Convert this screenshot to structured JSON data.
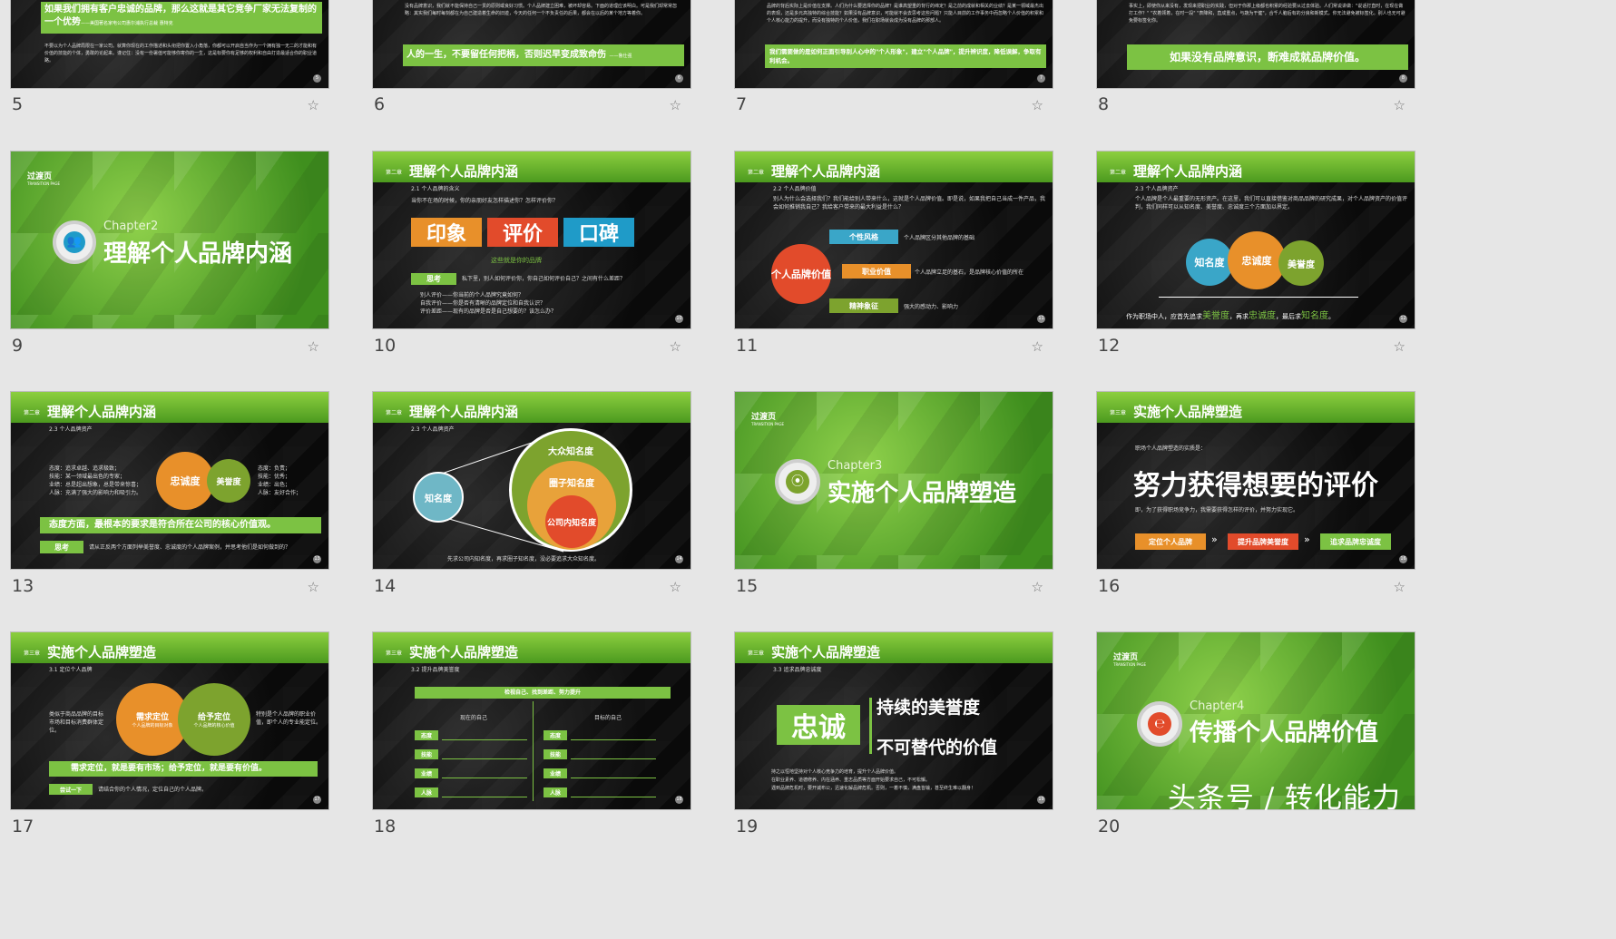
{
  "slides": [
    {
      "num": "5",
      "quote": "如果我们拥有客户忠诚的品牌，那么这就是其它竞争厂家无法复制的一个优势",
      "quote_src": "——美国著名家电公司惠尔浦执行总裁 惠特克",
      "body": "不要以为个人品牌局限在一家公司。就算你现在的工作描述和头衔把你置入小角落，你都可以开启自当作为一个拥有独一无二的才能和有价值的技能的个体，勇敢的论起来。谨记住：没有一份署值可能够你寄你的一生，这是标要你有足够的权利和自由打造最适合你的职业道路。"
    },
    {
      "num": "6",
      "body": "没有品牌意识，我们就不能保持自己一贯的原则或良好习惯。个人品牌建立困难，被坏却容易。下面的道理应该明白。可是我们却常常忽略：其实我们每时每刻都在为自己建造着生命的旧迹，今天的任何一个不负责任的后果，都会在以后的某个地方等着你。",
      "quote": "人的一生，不要留任何把柄，否则迟早变成致命伤",
      "quote_src": "——鲁仕强"
    },
    {
      "num": "7",
      "body": "品牌的背后实际上是价值在支撑。人们为什么要选择你的品牌？是谁高望重的背行的缔定？是之前的成就和相关的业绩？是某一领域最杰出的表现，还是多元高独特的综合技能？如果没有品牌意识，可能就不会去思考这些问题？只能人目前的工作事务中而忽略个人价值的积累和个人核心能力的提升，而没有独特的个人价值，我们在职场就会成为没有品牌的那部人。",
      "highlight": "我们需要做的是如何正面引导别人心中的\"个人形象\"，建立\"个人品牌\"，提升辨识度，降低误解，争取有利机会。"
    },
    {
      "num": "8",
      "body": "事实上，即使你从来没有，发现来把职业的实践，但对于你那上级都也积累的经验要从过去体验。人们常说讲做：\"说话打直时，在现在做打工作？\" \"农着领着，在时一段\" \"表降和，直成重点，与蔬为干健\"，合千人脑后有的分良和新模式，你无法避免被标签化。别人也无可避免要标签化你。",
      "bar": "如果没有品牌意识，断难成就品牌价值。"
    },
    {
      "num": "9",
      "label": "过渡页",
      "sub": "TRANSITION PAGE",
      "chapter": "Chapter2",
      "title": "理解个人品牌内涵"
    },
    {
      "num": "10",
      "chapter_tag": "第二章",
      "title": "理解个人品牌内涵",
      "subtitle": "2.1 个人品牌的含义",
      "q": "当你不在场的时候，你的亲朋好友怎样描述你？怎样评价你？",
      "tags": [
        "印象",
        "评价",
        "口碑"
      ],
      "tag_colors": [
        "#e8902a",
        "#e24b2b",
        "#1f9bc8"
      ],
      "caption": "这些就是你的品牌",
      "think": "思考",
      "think_text": "私下里，别人如何评价你，你自己如何评价自己？之间有什么差距？",
      "bullets": [
        "别人评价——你当前的个人品牌究竟如何？",
        "自我评价——你是否有清晰的品牌定位和自我认识？",
        "评价差距——现有的品牌是否是自己想要的？该怎么办？"
      ]
    },
    {
      "num": "11",
      "chapter_tag": "第二章",
      "title": "理解个人品牌内涵",
      "subtitle": "2.2 个人品牌价值",
      "intro": "别人为什么会选择我们？我们能给别人带来什么，这就是个人品牌价值。即是说，如果我把自己当成一件产品，我会如何推销我自己？我给客户带来的最大利益是什么？",
      "core": "个人品牌价值",
      "items": [
        {
          "label": "个性风格",
          "text": "个人品牌区分其他品牌的基础"
        },
        {
          "label": "职业价值",
          "text": "个人品牌立足的基石，是品牌核心价值的所在"
        },
        {
          "label": "精神象征",
          "text": "强大的感动力、影响力"
        }
      ]
    },
    {
      "num": "12",
      "chapter_tag": "第二章",
      "title": "理解个人品牌内涵",
      "subtitle": "2.3 个人品牌资产",
      "text": "个人品牌是个人最重要的无形资产。在这里，我们可以直接借鉴对商品品牌的研究成果，对个人品牌资产的价值评判，我们同样可以从知名度、美誉度、忠诚度三个方面加以界定。",
      "circles": [
        "知名度",
        "忠诚度",
        "美誉度"
      ],
      "conclusion_parts": [
        "作为职场中人，应首先追求",
        "美誉度",
        "，再求",
        "忠诚度",
        "，最后求",
        "知名度",
        "。"
      ]
    },
    {
      "num": "13",
      "chapter_tag": "第二章",
      "title": "理解个人品牌内涵",
      "subtitle": "2.3 个人品牌资产",
      "left_list": [
        "态度：追求卓越、追求极致；",
        "技能：某一领域最出色的专家；",
        "业绩：总是超出想象，总是带来惊喜；",
        "人脉：充满了强大的影响力和吸引力。"
      ],
      "right_list": [
        "态度：负责；",
        "技能：优秀；",
        "业绩：出色；",
        "人脉：友好合作；"
      ],
      "circles": [
        "忠诚度",
        "美誉度"
      ],
      "bar": "态度方面，最根本的要求是符合所在公司的核心价值观。",
      "think": "思考",
      "think_text": "请从正反两个方面列举美誉度、忠诚度的个人品牌案例，并思考他们是如何做到的？"
    },
    {
      "num": "14",
      "chapter_tag": "第二章",
      "title": "理解个人品牌内涵",
      "subtitle": "2.3 个人品牌资产",
      "small_circle": "知名度",
      "rings": [
        "大众知名度",
        "圈子知名度",
        "公司内知名度"
      ],
      "ring_note": "行业职业",
      "foot": "先求公司内知名度，再求圈子知名度，没必要追求大众知名度。"
    },
    {
      "num": "15",
      "label": "过渡页",
      "sub": "TRANSITION PAGE",
      "chapter": "Chapter3",
      "title": "实施个人品牌塑造"
    },
    {
      "num": "16",
      "chapter_tag": "第三章",
      "title": "实施个人品牌塑造",
      "lead": "职场个人品牌塑造的实质是：",
      "big": "努力获得想要的评价",
      "desc": "即，为了获得职场竞争力，我需要获得怎样的评价，并努力实现它。",
      "steps": [
        "定位个人品牌",
        "提升品牌美誉度",
        "追求品牌忠诚度"
      ],
      "step_colors": [
        "#e8902a",
        "#e24b2b",
        "#7cc243"
      ]
    },
    {
      "num": "17",
      "chapter_tag": "第三章",
      "title": "实施个人品牌塑造",
      "subtitle": "3.1 定位个人品牌",
      "left_text": "类似于商品品牌的目标市场和目标消费群体定位。",
      "right_text": "特别是个人品牌的职业价值，即个人的专业能定位。",
      "c1": "需求定位",
      "c1_sub": "个人品牌的目标对象",
      "c2": "给予定位",
      "c2_sub": "个人品牌的核心价值",
      "bar": "需求定位，就是要有市场；给予定位，就是要有价值。",
      "try": "尝试一下",
      "try_text": "请结合你的个人情况，定位自己的个人品牌。"
    },
    {
      "num": "18",
      "chapter_tag": "第三章",
      "title": "实施个人品牌塑造",
      "subtitle": "3.2 提升品牌美誉度",
      "top": "检视自己、找到差距、努力提升",
      "col1": "现在的自己",
      "col2": "目标的自己",
      "rows": [
        "态度",
        "技能",
        "业绩",
        "人脉"
      ]
    },
    {
      "num": "19",
      "chapter_tag": "第三章",
      "title": "实施个人品牌塑造",
      "subtitle": "3.3 追求品牌忠诚度",
      "big": "忠诚",
      "t1": "持续的美誉度",
      "t2": "不可替代的价值",
      "foot": [
        "持之以恒地坚持对个人核心竞争力的培育，提升个人品牌价值。",
        "在职业素养、道德修养、内在涵养、重志品质等方面开始要求自己，不可松懈。",
        "遇到品牌危机时，要开诚布公，迅速化解品牌危机。否则，一着不慎，满盘皆输，甚至终生难以翻身！"
      ]
    },
    {
      "num": "20",
      "label": "过渡页",
      "sub": "TRANSITION PAGE",
      "chapter": "Chapter4",
      "title": "传播个人品牌价值"
    }
  ],
  "watermark": "头条号 / 转化能力",
  "star_icon": "☆"
}
